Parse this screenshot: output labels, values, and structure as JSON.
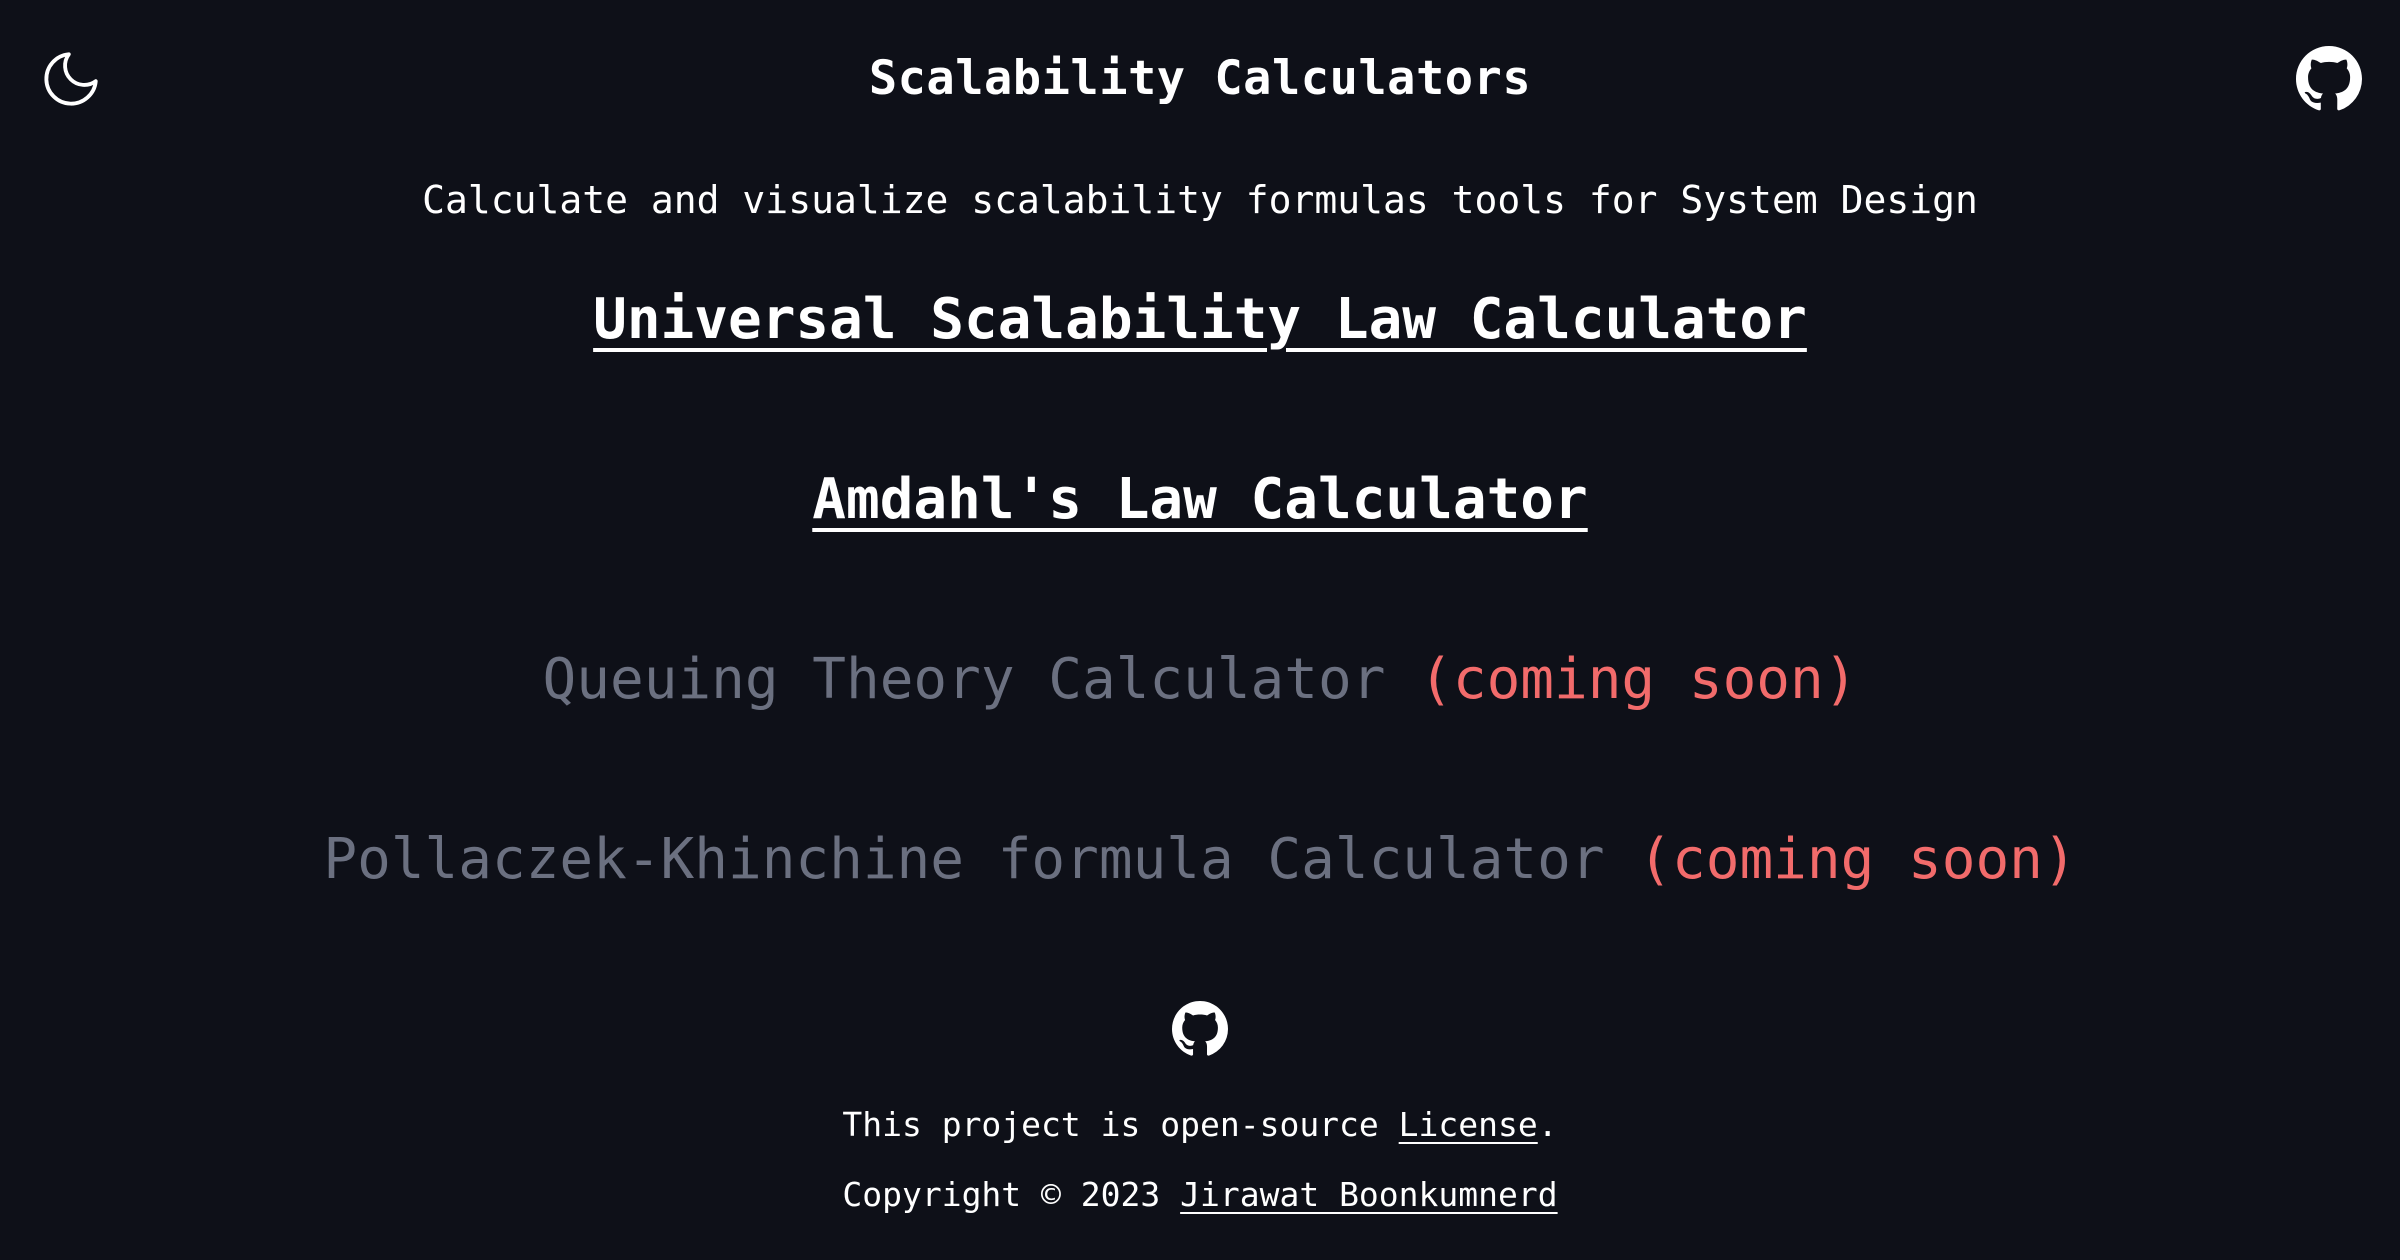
{
  "header": {
    "title": "Scalability Calculators",
    "theme_icon": "moon-icon",
    "github_icon": "github-icon"
  },
  "subtitle": "Calculate and visualize scalability formulas tools for System Design",
  "calculators": [
    {
      "label": "Universal Scalability Law Calculator",
      "status": ""
    },
    {
      "label": "Amdahl's Law Calculator",
      "status": ""
    },
    {
      "label": "Queuing Theory Calculator",
      "status": "(coming soon)"
    },
    {
      "label": "Pollaczek-Khinchine formula Calculator",
      "status": "(coming soon)"
    }
  ],
  "footer": {
    "github_icon": "github-icon",
    "open_source_text": "This project is open-source",
    "license_link": "License",
    "period": ".",
    "copyright_text": "Copyright © 2023",
    "author_link": "Jirawat Boonkumnerd"
  },
  "colors": {
    "background": "#0e1018",
    "text": "#ffffff",
    "disabled": "#6b7080",
    "coming_soon": "#f26b6b"
  }
}
